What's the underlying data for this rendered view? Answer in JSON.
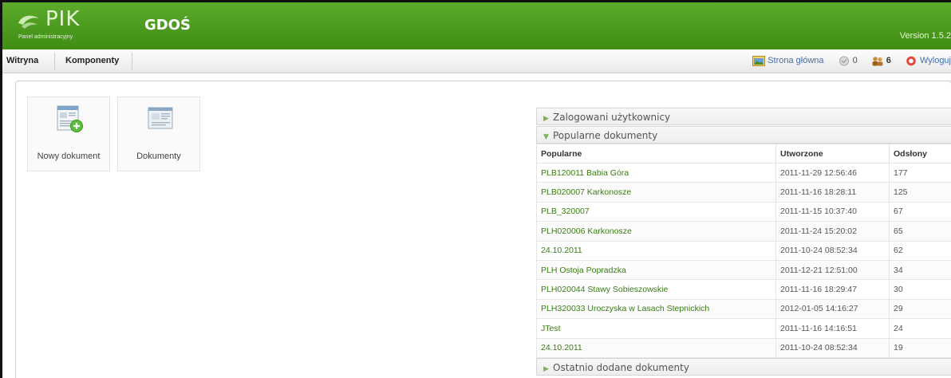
{
  "header": {
    "logo_text": "PIK",
    "logo_sub": "Panel administracyjny",
    "site_title": "GDOŚ",
    "version": "Version 1.5.2"
  },
  "menu": {
    "items": [
      {
        "label": "Witryna"
      },
      {
        "label": "Komponenty"
      }
    ]
  },
  "status": {
    "preview": "Strona główna",
    "messages_count": "0",
    "users_count": "6",
    "logout": "Wyloguj"
  },
  "cpanel": {
    "tiles": [
      {
        "label": "Nowy dokument",
        "icon": "new-document-icon"
      },
      {
        "label": "Dokumenty",
        "icon": "documents-icon"
      }
    ]
  },
  "sliders": {
    "logged_users": "Zalogowani użytkownicy",
    "popular": "Popularne dokumenty",
    "latest": "Ostatnio dodane dokumenty"
  },
  "popular_table": {
    "headers": [
      "Popularne",
      "Utworzone",
      "Odsłony"
    ],
    "rows": [
      [
        "PLB120011 Babia Góra",
        "2011-11-29 12:56:46",
        "177"
      ],
      [
        "PLB020007 Karkonosze",
        "2011-11-16 18:28:11",
        "125"
      ],
      [
        "PLB_320007",
        "2011-11-15 10:37:40",
        "67"
      ],
      [
        "PLH020006 Karkonosze",
        "2011-11-24 15:20:02",
        "65"
      ],
      [
        "24.10.2011",
        "2011-10-24 08:52:34",
        "62"
      ],
      [
        "PLH Ostoja Popradzka",
        "2011-12-21 12:51:00",
        "34"
      ],
      [
        "PLH020044 Stawy Sobieszowskie",
        "2011-11-16 18:29:47",
        "30"
      ],
      [
        "PLH320033 Uroczyska w Lasach Stepnickich",
        "2012-01-05 14:16:27",
        "29"
      ],
      [
        "JTest",
        "2011-11-16 14:16:51",
        "24"
      ],
      [
        "24.10.2011",
        "2011-10-24 08:52:34",
        "19"
      ]
    ]
  },
  "colors": {
    "header_green": "#4a9a1f",
    "link_green": "#3a7d15",
    "logout_red": "#d9342b"
  }
}
